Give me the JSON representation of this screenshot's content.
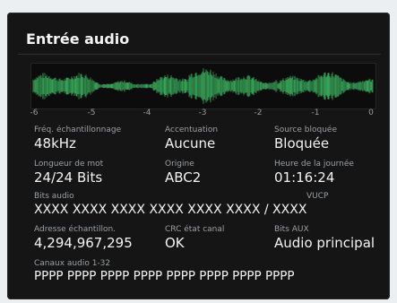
{
  "panel": {
    "title": "Entrée audio"
  },
  "meter": {
    "scale": [
      "-6",
      "-5",
      "-4",
      "-3",
      "-2",
      "-1",
      "0"
    ],
    "waveform_color": "#38a85a"
  },
  "fields": {
    "freq_label": "Fréq. échantillonnage",
    "freq_value": "48kHz",
    "accent_label": "Accentuation",
    "accent_value": "Aucune",
    "source_label": "Source bloquée",
    "source_value": "Bloquée",
    "wordlen_label": "Longueur de mot",
    "wordlen_value": "24/24 Bits",
    "origin_label": "Origine",
    "origin_value": "ABC2",
    "time_label": "Heure de la journée",
    "time_value": "01:16:24",
    "bits_label": "Bits audio",
    "vucp_label": "VUCP",
    "bits_value": "XXXX XXXX XXXX XXXX XXXX XXXX / XXXX",
    "addr_label": "Adresse échantillon.",
    "addr_value": "4,294,967,295",
    "crc_label": "CRC état canal",
    "crc_value": "OK",
    "aux_label": "Bits AUX",
    "aux_value": "Audio principal",
    "channels_label": "Canaux audio 1-32",
    "channels_value": "PPPP PPPP PPPP PPPP PPPP PPPP PPPP PPPP"
  }
}
